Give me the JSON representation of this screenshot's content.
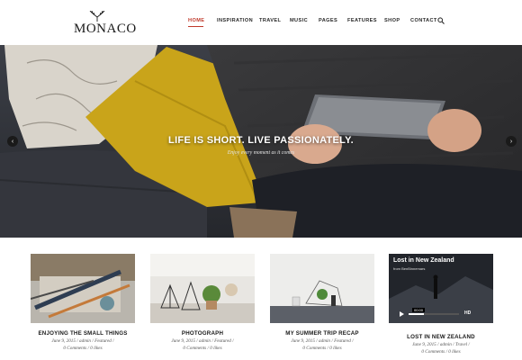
{
  "header": {
    "logo_text": "MONACO",
    "nav": [
      {
        "label": "HOME",
        "active": true
      },
      {
        "label": "INSPIRATION",
        "active": false
      },
      {
        "label": "TRAVEL",
        "active": false
      },
      {
        "label": "MUSIC",
        "active": false
      },
      {
        "label": "PAGES",
        "active": false
      },
      {
        "label": "FEATURES",
        "active": false
      },
      {
        "label": "SHOP",
        "active": false
      },
      {
        "label": "CONTACT",
        "active": false
      }
    ],
    "search_icon": "search-icon"
  },
  "hero": {
    "title": "LIFE IS SHORT. LIVE PASSIONATELY.",
    "subtitle": "Enjoy every moment as it comes",
    "prev_icon": "chevron-left-icon",
    "next_icon": "chevron-right-icon"
  },
  "posts": [
    {
      "title": "ENJOYING THE SMALL THINGS",
      "date": "June 9, 2015",
      "author": "admin",
      "category": "Featured",
      "comments": "0 Comments",
      "likes": "0 likes"
    },
    {
      "title": "PHOTOGRAPH",
      "date": "June 9, 2015",
      "author": "admin",
      "category": "Featured",
      "comments": "0 Comments",
      "likes": "0 likes"
    },
    {
      "title": "MY SUMMER TRIP RECAP",
      "date": "June 9, 2015",
      "author": "admin",
      "category": "Featured",
      "comments": "0 Comments",
      "likes": "0 likes"
    },
    {
      "title": "LOST IN NEW ZEALAND",
      "date": "June 9, 2015",
      "author": "admin",
      "category": "Travel",
      "comments": "0 Comments",
      "likes": "0 likes",
      "video": {
        "title": "Lost in New Zealand",
        "from": "from BenBinnemars",
        "time": "00:00",
        "hd": "HD",
        "progress": 0.3
      }
    }
  ],
  "colors": {
    "accent": "#c0392b",
    "hero_bg": "#2b2d33",
    "pillow_yellow": "#c9a41a"
  }
}
